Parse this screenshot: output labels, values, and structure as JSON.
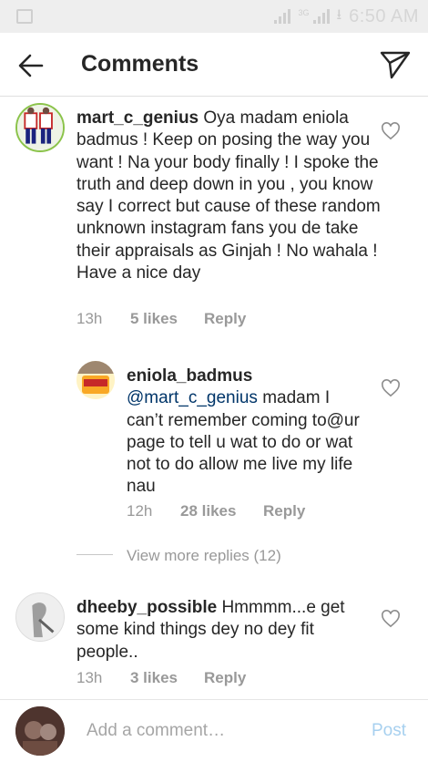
{
  "status_bar": {
    "time": "6:50 AM",
    "network": "3G"
  },
  "header": {
    "title": "Comments"
  },
  "comments": [
    {
      "username": "mart_c_genius",
      "text": "Oya madam eniola badmus ! Keep on posing the way you want ! Na your body finally ! I spoke the truth and deep down in you , you know say I correct but cause of these random unknown instagram fans you de take their appraisals as Ginjah ! No wahala ! Have a nice day",
      "time": "13h",
      "likes": "5 likes",
      "reply": "Reply"
    },
    {
      "username": "eniola_badmus",
      "mention": "@mart_c_genius",
      "text": "madam I can’t remember coming to@ur page to tell u wat to do or wat not to do allow me live my life nau",
      "time": "12h",
      "likes": "28 likes",
      "reply": "Reply"
    },
    {
      "username": "dheeby_possible",
      "text": "Hmmmm...e get some kind things dey no dey fit people..",
      "time": "13h",
      "likes": "3 likes",
      "reply": "Reply"
    }
  ],
  "view_more_replies": "View more replies (12)",
  "composer": {
    "placeholder": "Add a comment…",
    "post_label": "Post"
  },
  "colors": {
    "text": "#262626",
    "meta": "#999999",
    "mention": "#003569",
    "post_disabled": "#a7d0ef",
    "status_bar": "#eeeeee"
  },
  "icons": [
    "image-icon",
    "signal-icon",
    "download-icon",
    "back-arrow-icon",
    "send-icon",
    "heart-icon"
  ]
}
